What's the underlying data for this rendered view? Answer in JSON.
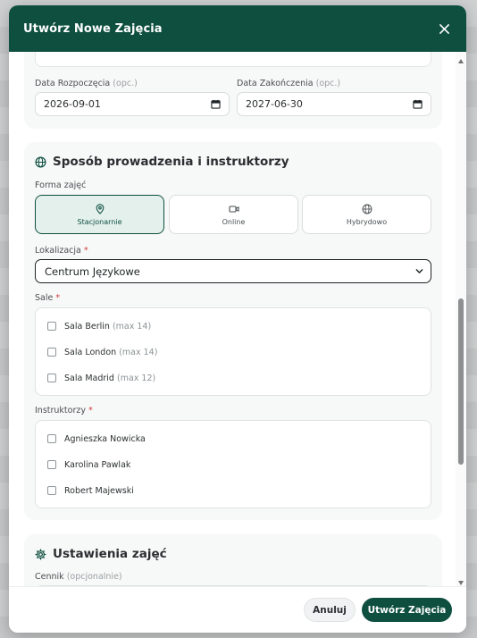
{
  "modal": {
    "title": "Utwórz Nowe Zajęcia"
  },
  "dates": {
    "start_label": "Data Rozpoczęcia",
    "start_optional": "(opc.)",
    "start_value": "2026-09-01",
    "end_label": "Data Zakończenia",
    "end_optional": "(opc.)",
    "end_value": "2027-06-30"
  },
  "mode_section": {
    "title": "Sposób prowadzenia i instruktorzy",
    "form_label": "Forma zajęć",
    "modes": [
      {
        "label": "Stacjonarnie",
        "icon": "map-pin-icon",
        "selected": true
      },
      {
        "label": "Online",
        "icon": "video-icon",
        "selected": false
      },
      {
        "label": "Hybrydowo",
        "icon": "globe-icon",
        "selected": false
      }
    ],
    "location_label": "Lokalizacja",
    "required_mark": "*",
    "location_value": "Centrum Językowe",
    "rooms_label": "Sale",
    "rooms": [
      {
        "name": "Sala Berlin",
        "capacity": "(max 14)"
      },
      {
        "name": "Sala London",
        "capacity": "(max 14)"
      },
      {
        "name": "Sala Madrid",
        "capacity": "(max 12)"
      }
    ],
    "instructors_label": "Instruktorzy",
    "instructors": [
      {
        "name": "Agnieszka Nowicka"
      },
      {
        "name": "Karolina Pawlak"
      },
      {
        "name": "Robert Majewski"
      }
    ]
  },
  "settings_section": {
    "title": "Ustawienia zajęć",
    "pricing_label": "Cennik",
    "pricing_optional": "(opcjonalnie)"
  },
  "footer": {
    "cancel_label": "Anuluj",
    "create_label": "Utwórz Zajęcia"
  },
  "colors": {
    "primary": "#0e4f3f",
    "selected_bg": "#e3f0ec",
    "required": "#d33a3a"
  }
}
